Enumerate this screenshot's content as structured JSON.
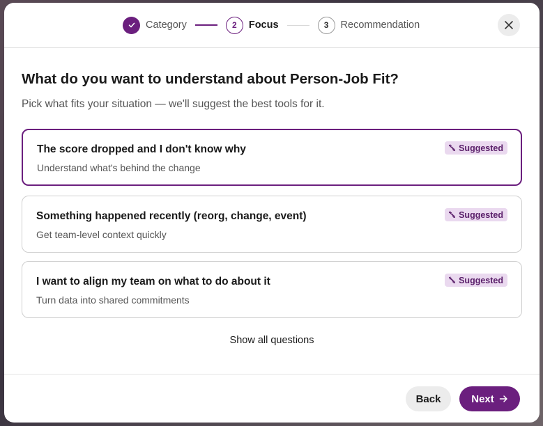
{
  "stepper": {
    "steps": [
      {
        "number": "1",
        "label": "Category",
        "state": "done",
        "icon": "check-icon"
      },
      {
        "number": "2",
        "label": "Focus",
        "state": "active"
      },
      {
        "number": "3",
        "label": "Recommendation",
        "state": "pending"
      }
    ]
  },
  "header": {
    "close_icon": "close-icon"
  },
  "main": {
    "title": "What do you want to understand about Person-Job Fit?",
    "subtitle": "Pick what fits your situation — we'll suggest the best tools for it.",
    "options": [
      {
        "title": "The score dropped and I don't know why",
        "description": "Understand what's behind the change",
        "badge": "Suggested",
        "selected": true
      },
      {
        "title": "Something happened recently (reorg, change, event)",
        "description": "Get team-level context quickly",
        "badge": "Suggested",
        "selected": false
      },
      {
        "title": "I want to align my team on what to do about it",
        "description": "Turn data into shared commitments",
        "badge": "Suggested",
        "selected": false
      }
    ],
    "show_all_label": "Show all questions"
  },
  "footer": {
    "back_label": "Back",
    "next_label": "Next"
  },
  "colors": {
    "accent": "#6b1f7e",
    "badge_bg": "#ead9ef",
    "neutral_button": "#ececec"
  }
}
